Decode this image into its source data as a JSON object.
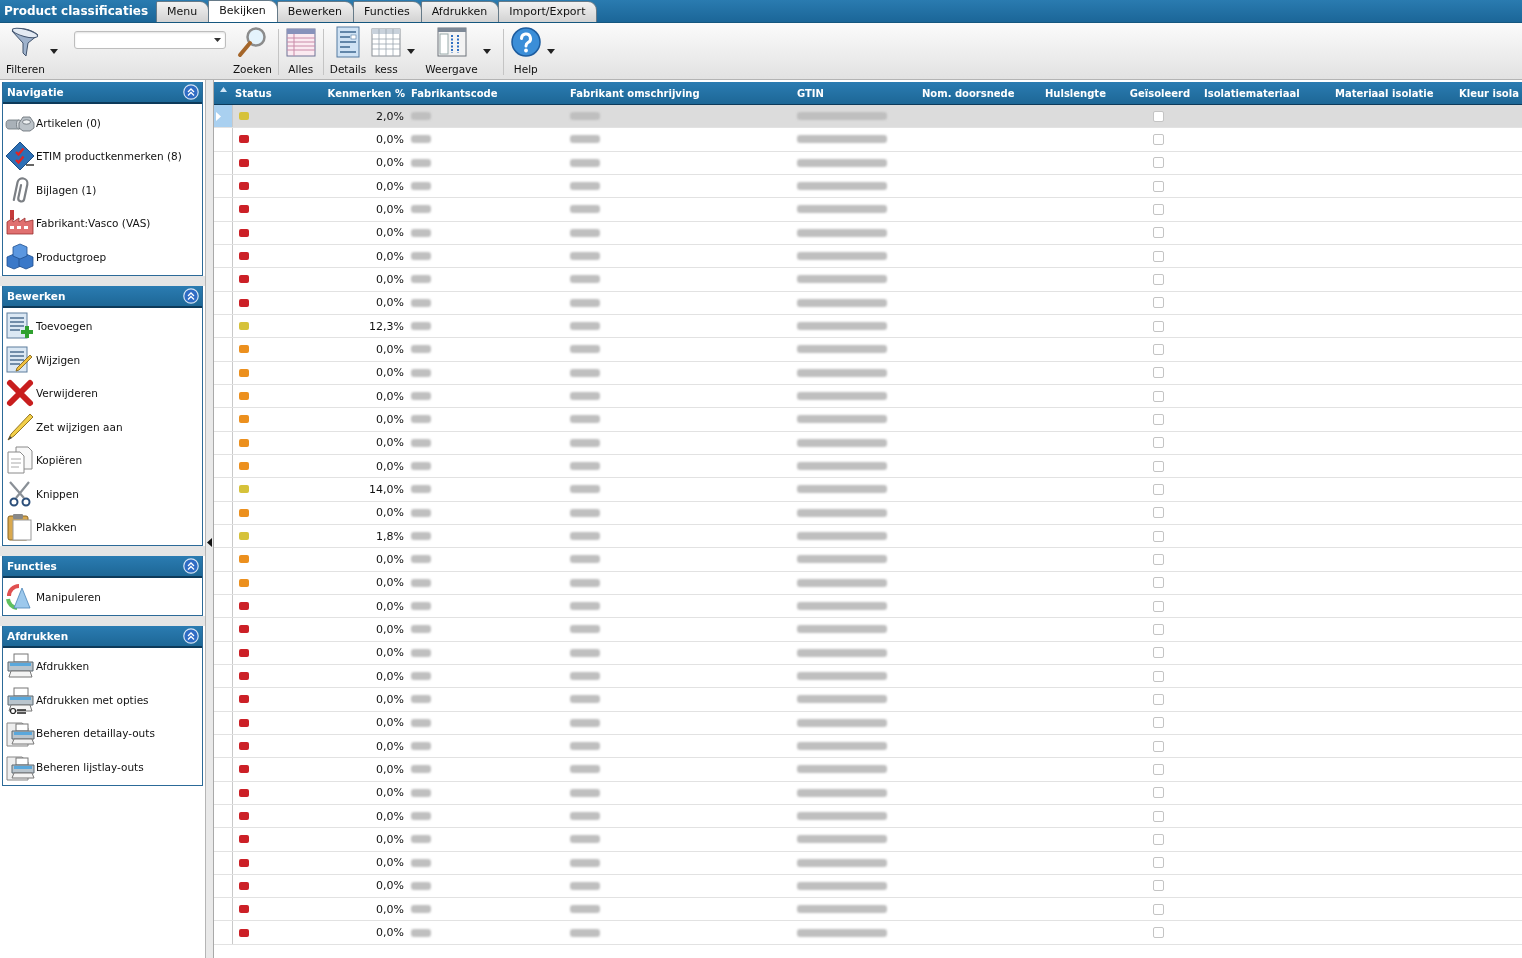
{
  "header": {
    "title": "Product classificaties",
    "tabs": [
      {
        "label": "Menu",
        "selected": false
      },
      {
        "label": "Bekijken",
        "selected": true
      },
      {
        "label": "Bewerken",
        "selected": false
      },
      {
        "label": "Functies",
        "selected": false
      },
      {
        "label": "Afdrukken",
        "selected": false
      },
      {
        "label": "Import/Export",
        "selected": false
      }
    ]
  },
  "toolbar": {
    "groups": [
      [
        {
          "kind": "button",
          "label": "Filteren",
          "dropdown": true
        },
        {
          "kind": "combobox"
        },
        {
          "kind": "button",
          "label": "Zoeken",
          "dropdown": false
        }
      ],
      [
        {
          "kind": "button",
          "label": "Alles",
          "dropdown": false
        }
      ],
      [
        {
          "kind": "button",
          "label": "Details",
          "dropdown": false
        },
        {
          "kind": "button",
          "label": "kess",
          "dropdown": true
        },
        {
          "kind": "button",
          "label": "Weergave",
          "dropdown": true
        }
      ],
      [
        {
          "kind": "button",
          "label": "Help",
          "dropdown": true
        }
      ]
    ]
  },
  "sidebar": {
    "panels": [
      {
        "title": "Navigatie",
        "expanded": true,
        "items": [
          {
            "label": "Artikelen (0)"
          },
          {
            "label": "ETIM productkenmerken (8)"
          },
          {
            "label": "Bijlagen (1)"
          },
          {
            "label": "Fabrikant:Vasco (VAS)"
          },
          {
            "label": "Productgroep"
          }
        ]
      },
      {
        "title": "Bewerken",
        "expanded": true,
        "items": [
          {
            "label": "Toevoegen"
          },
          {
            "label": "Wijzigen"
          },
          {
            "label": "Verwijderen"
          },
          {
            "label": "Zet wijzigen aan"
          },
          {
            "label": "Kopiëren"
          },
          {
            "label": "Knippen"
          },
          {
            "label": "Plakken"
          }
        ]
      },
      {
        "title": "Functies",
        "expanded": true,
        "items": [
          {
            "label": "Manipuleren"
          }
        ]
      },
      {
        "title": "Afdrukken",
        "expanded": true,
        "items": [
          {
            "label": "Afdrukken"
          },
          {
            "label": "Afdrukken met opties"
          },
          {
            "label": "Beheren detaillay-outs"
          },
          {
            "label": "Beheren lijstlay-outs"
          }
        ]
      }
    ]
  },
  "table": {
    "columns": [
      {
        "label": "Status",
        "kind": "status"
      },
      {
        "label": "Kenmerken %",
        "kind": "percent"
      },
      {
        "label": "Fabrikantscode",
        "kind": "redacted"
      },
      {
        "label": "Fabrikant omschrijving",
        "kind": "redacted"
      },
      {
        "label": "GTIN",
        "kind": "redacted"
      },
      {
        "label": "Nom. doorsnede",
        "kind": "empty"
      },
      {
        "label": "Hulslengte",
        "kind": "empty"
      },
      {
        "label": "Geïsoleerd",
        "kind": "checkbox"
      },
      {
        "label": "Isolatiemateriaal",
        "kind": "empty"
      },
      {
        "label": "Materiaal isolatie",
        "kind": "empty"
      },
      {
        "label": "Kleur isola",
        "kind": "empty"
      }
    ],
    "rows": [
      {
        "selected": true,
        "color": "#d6c23a",
        "kenmerken": "2,0%",
        "checked": false
      },
      {
        "selected": false,
        "color": "#cc2027",
        "kenmerken": "0,0%",
        "checked": false
      },
      {
        "selected": false,
        "color": "#cc2027",
        "kenmerken": "0,0%",
        "checked": false
      },
      {
        "selected": false,
        "color": "#cc2027",
        "kenmerken": "0,0%",
        "checked": false
      },
      {
        "selected": false,
        "color": "#cc2027",
        "kenmerken": "0,0%",
        "checked": false
      },
      {
        "selected": false,
        "color": "#cc2027",
        "kenmerken": "0,0%",
        "checked": false
      },
      {
        "selected": false,
        "color": "#cc2027",
        "kenmerken": "0,0%",
        "checked": false
      },
      {
        "selected": false,
        "color": "#cc2027",
        "kenmerken": "0,0%",
        "checked": false
      },
      {
        "selected": false,
        "color": "#cc2027",
        "kenmerken": "0,0%",
        "checked": false
      },
      {
        "selected": false,
        "color": "#d6c23a",
        "kenmerken": "12,3%",
        "checked": false
      },
      {
        "selected": false,
        "color": "#ec901e",
        "kenmerken": "0,0%",
        "checked": false
      },
      {
        "selected": false,
        "color": "#ec901e",
        "kenmerken": "0,0%",
        "checked": false
      },
      {
        "selected": false,
        "color": "#ec901e",
        "kenmerken": "0,0%",
        "checked": false
      },
      {
        "selected": false,
        "color": "#ec901e",
        "kenmerken": "0,0%",
        "checked": false
      },
      {
        "selected": false,
        "color": "#ec901e",
        "kenmerken": "0,0%",
        "checked": false
      },
      {
        "selected": false,
        "color": "#ec901e",
        "kenmerken": "0,0%",
        "checked": false
      },
      {
        "selected": false,
        "color": "#d6c23a",
        "kenmerken": "14,0%",
        "checked": false
      },
      {
        "selected": false,
        "color": "#ec901e",
        "kenmerken": "0,0%",
        "checked": false
      },
      {
        "selected": false,
        "color": "#d6c23a",
        "kenmerken": "1,8%",
        "checked": false
      },
      {
        "selected": false,
        "color": "#ec901e",
        "kenmerken": "0,0%",
        "checked": false
      },
      {
        "selected": false,
        "color": "#ec901e",
        "kenmerken": "0,0%",
        "checked": false
      },
      {
        "selected": false,
        "color": "#cc2027",
        "kenmerken": "0,0%",
        "checked": false
      },
      {
        "selected": false,
        "color": "#cc2027",
        "kenmerken": "0,0%",
        "checked": false
      },
      {
        "selected": false,
        "color": "#cc2027",
        "kenmerken": "0,0%",
        "checked": false
      },
      {
        "selected": false,
        "color": "#cc2027",
        "kenmerken": "0,0%",
        "checked": false
      },
      {
        "selected": false,
        "color": "#cc2027",
        "kenmerken": "0,0%",
        "checked": false
      },
      {
        "selected": false,
        "color": "#cc2027",
        "kenmerken": "0,0%",
        "checked": false
      },
      {
        "selected": false,
        "color": "#cc2027",
        "kenmerken": "0,0%",
        "checked": false
      },
      {
        "selected": false,
        "color": "#cc2027",
        "kenmerken": "0,0%",
        "checked": false
      },
      {
        "selected": false,
        "color": "#cc2027",
        "kenmerken": "0,0%",
        "checked": false
      },
      {
        "selected": false,
        "color": "#cc2027",
        "kenmerken": "0,0%",
        "checked": false
      },
      {
        "selected": false,
        "color": "#cc2027",
        "kenmerken": "0,0%",
        "checked": false
      },
      {
        "selected": false,
        "color": "#cc2027",
        "kenmerken": "0,0%",
        "checked": false
      },
      {
        "selected": false,
        "color": "#cc2027",
        "kenmerken": "0,0%",
        "checked": false
      },
      {
        "selected": false,
        "color": "#cc2027",
        "kenmerken": "0,0%",
        "checked": false
      },
      {
        "selected": false,
        "color": "#cc2027",
        "kenmerken": "0,0%",
        "checked": false
      }
    ]
  }
}
